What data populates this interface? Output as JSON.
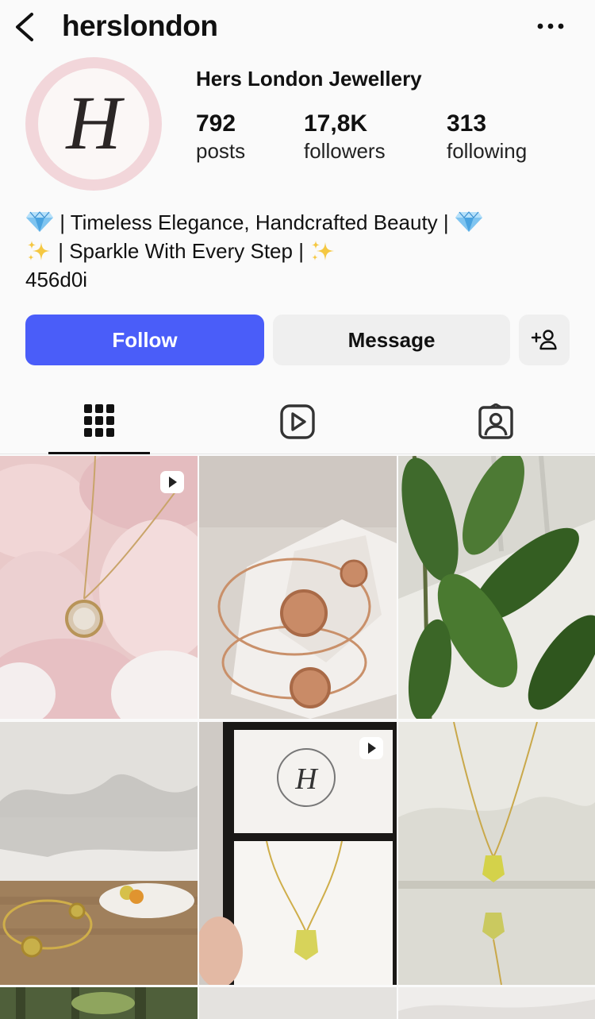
{
  "header": {
    "username": "herslondon"
  },
  "profile": {
    "avatar_letter": "H",
    "display_name": "Hers London Jewellery",
    "stats": {
      "posts_count": "792",
      "posts_label": "posts",
      "followers_count": "17,8K",
      "followers_label": "followers",
      "following_count": "313",
      "following_label": "following"
    },
    "bio": {
      "line1_text": " | Timeless Elegance, Handcrafted Beauty | ",
      "line2_text": " | Sparkle With Every Step | ",
      "line3_text": "456d0i"
    }
  },
  "actions": {
    "follow_label": "Follow",
    "message_label": "Message",
    "add_label": "+"
  },
  "tabs": [
    {
      "icon": "grid-icon",
      "selected": true
    },
    {
      "icon": "reels-icon",
      "selected": false
    },
    {
      "icon": "tagged-icon",
      "selected": false
    }
  ],
  "posts": [
    {
      "subject": "necklace on rose petals",
      "is_video": true
    },
    {
      "subject": "rose gold cuff bracelet on stone",
      "is_video": false
    },
    {
      "subject": "green plant in sunlight",
      "is_video": false
    },
    {
      "subject": "bangle and dish on wooden table",
      "is_video": false
    },
    {
      "subject": "hamsa necklace in gift box",
      "is_video": true
    },
    {
      "subject": "hamsa pendant on chain",
      "is_video": false
    }
  ],
  "colors": {
    "accent": "#4a5df9",
    "button_secondary": "#efefef",
    "background": "#fafafa",
    "avatar_ring": "#f2d6da"
  }
}
